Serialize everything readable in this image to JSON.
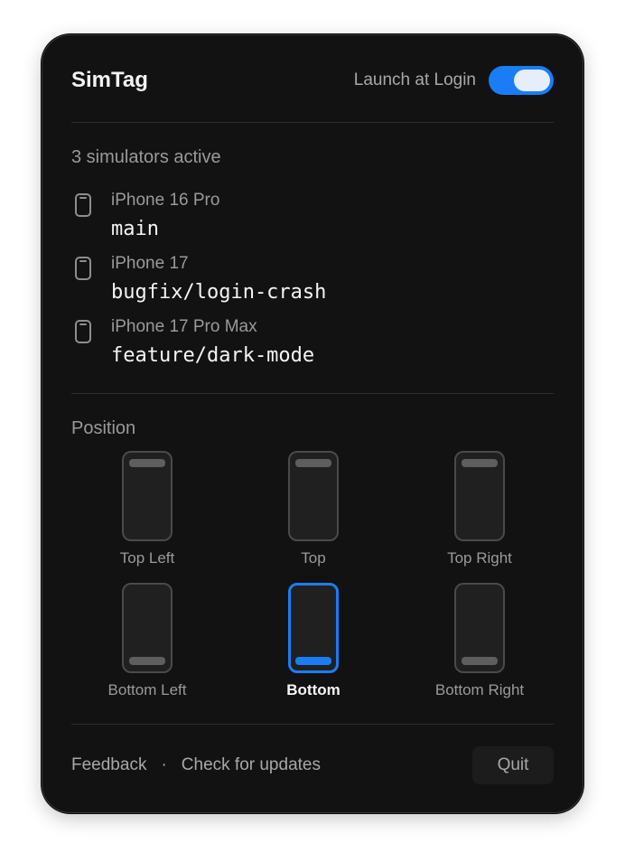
{
  "header": {
    "title": "SimTag",
    "launch_at_login_label": "Launch at Login",
    "launch_at_login_on": true
  },
  "simulators": {
    "count_label": "3 simulators active",
    "items": [
      {
        "device": "iPhone 16 Pro",
        "branch": "main",
        "icon": "phone-icon"
      },
      {
        "device": "iPhone 17",
        "branch": "bugfix/login-crash",
        "icon": "phone-icon"
      },
      {
        "device": "iPhone 17 Pro Max",
        "branch": "feature/dark-mode",
        "icon": "phone-icon"
      }
    ]
  },
  "position": {
    "heading": "Position",
    "options": [
      {
        "label": "Top Left",
        "bar": "top",
        "selected": false
      },
      {
        "label": "Top",
        "bar": "top",
        "selected": false
      },
      {
        "label": "Top Right",
        "bar": "top",
        "selected": false
      },
      {
        "label": "Bottom Left",
        "bar": "bottom",
        "selected": false
      },
      {
        "label": "Bottom",
        "bar": "bottom",
        "selected": true
      },
      {
        "label": "Bottom Right",
        "bar": "bottom",
        "selected": false
      }
    ]
  },
  "footer": {
    "feedback_label": "Feedback",
    "separator": "·",
    "updates_label": "Check for updates",
    "quit_label": "Quit"
  },
  "colors": {
    "accent": "#1a7df5",
    "panel_background": "#121212"
  }
}
